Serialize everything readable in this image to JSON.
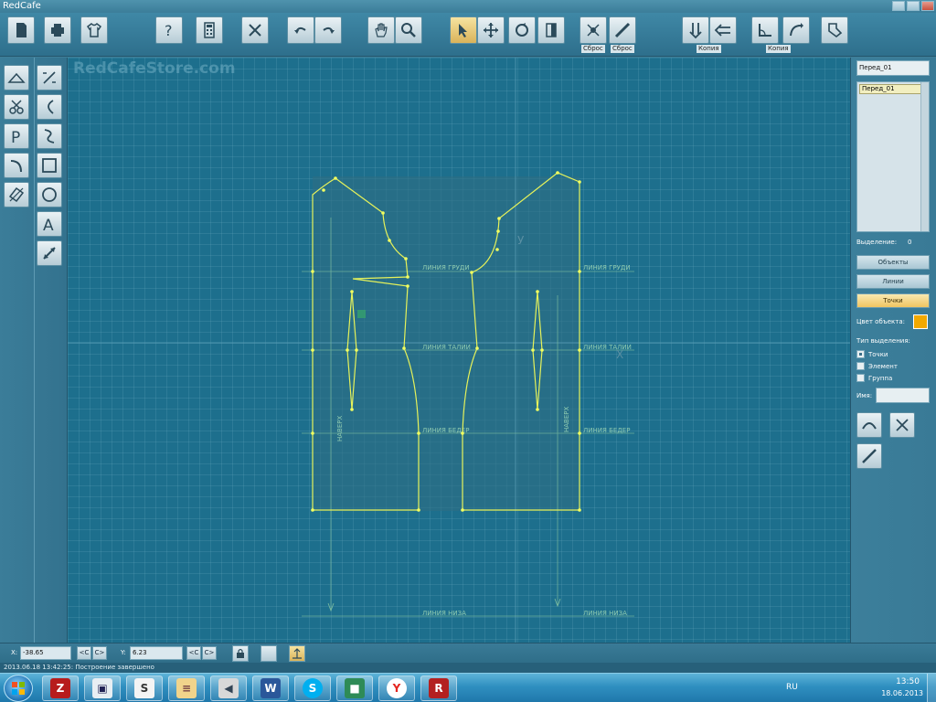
{
  "window": {
    "title": "RedCafe"
  },
  "toolbar": {
    "reset_label_1": "Сброс",
    "reset_label_2": "Сброс",
    "copy_label_1": "Копия",
    "copy_label_2": "Копия"
  },
  "canvas": {
    "watermark": "RedCafeStore.com",
    "lines": {
      "chest": "ЛИНИЯ ГРУДИ",
      "waist": "ЛИНИЯ ТАЛИИ",
      "hips": "ЛИНИЯ БЕДЕР",
      "bottom": "ЛИНИЯ НИЗА",
      "grain": "НАВЕРХ"
    }
  },
  "right_panel": {
    "piece_name": "Перед_01",
    "pieces": [
      "Перед_01"
    ],
    "selection_label": "Выделение:",
    "selection_count": "0",
    "btn_objects": "Объекты",
    "btn_lines": "Линии",
    "btn_points": "Точки",
    "color_label": "Цвет объекта:",
    "object_color": "#f2a900",
    "selection_type_label": "Тип выделения:",
    "opt_points": "Точки",
    "opt_element": "Элемент",
    "opt_group": "Группа",
    "name_label": "Имя:",
    "name_value": ""
  },
  "coords": {
    "x_label": "X:",
    "x_value": "-38.65",
    "y_label": "Y:",
    "y_value": "6.23",
    "prev": "<C",
    "next": "C>"
  },
  "status": {
    "message": "2013.06.18 13:42:25: Построение завершено"
  },
  "taskbar": {
    "lang": "RU",
    "time": "13:50",
    "date": "18.06.2013"
  },
  "colors": {
    "pattern_line": "#e6f25a",
    "canvas_bg": "#1d6f8d",
    "active_tool": "#f0c461"
  }
}
